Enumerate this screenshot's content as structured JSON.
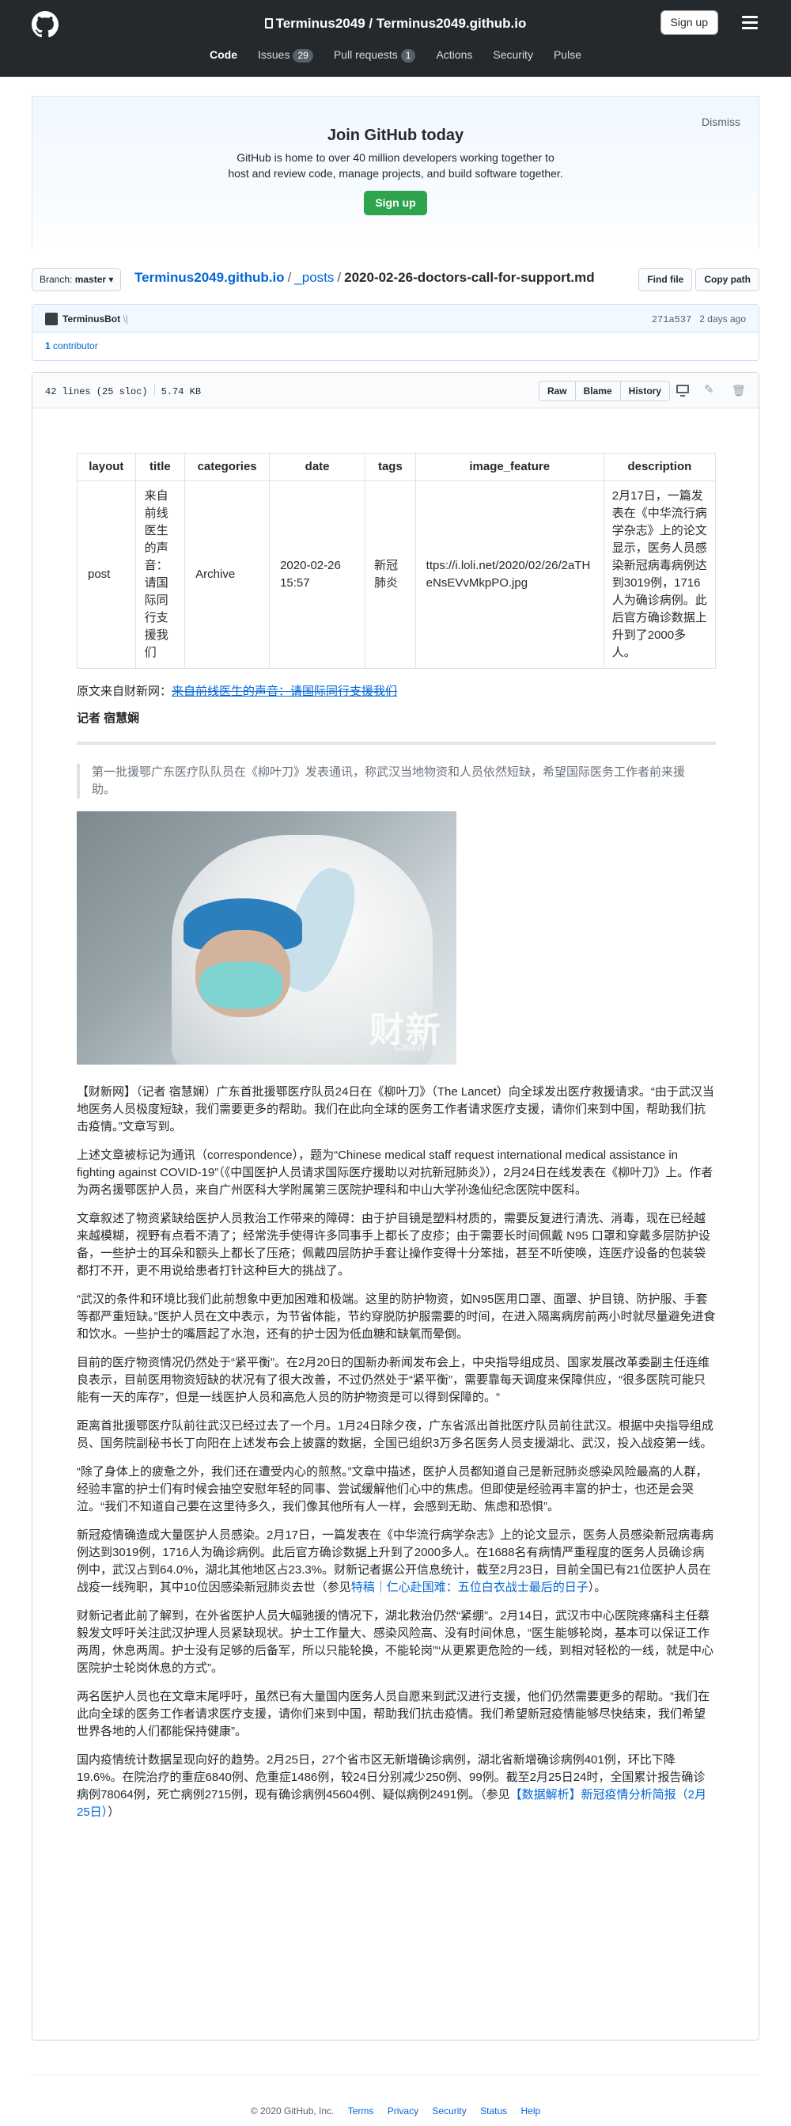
{
  "header": {
    "owner": "Terminus2049",
    "repo": "Terminus2049.github.io",
    "signin_label": "Sign up",
    "nav": [
      {
        "label": "Code",
        "active": true
      },
      {
        "label": "Issues",
        "count": "29"
      },
      {
        "label": "Pull requests",
        "count": "1"
      },
      {
        "label": "Actions"
      },
      {
        "label": "Security"
      },
      {
        "label": "Pulse"
      }
    ]
  },
  "join": {
    "title": "Join GitHub today",
    "text": "GitHub is home to over 40 million developers working together to host and review code, manage projects, and build software together.",
    "button": "Sign up",
    "dismiss": "Dismiss"
  },
  "filenav": {
    "branch_label": "Branch:",
    "branch": "master",
    "crumb_repo": "Terminus2049.github.io",
    "crumb_dir": "_posts",
    "crumb_file": "2020-02-26-doctors-call-for-support.md",
    "find_file": "Find file",
    "copy_path": "Copy path"
  },
  "commit": {
    "author": "TerminusBot",
    "message": "\\|",
    "sha": "271a537",
    "time": "2 days ago",
    "contributors_count": "1",
    "contributors_label": "contributor"
  },
  "file": {
    "lines": "42 lines (25 sloc)",
    "size": "5.74 KB",
    "raw": "Raw",
    "blame": "Blame",
    "history": "History"
  },
  "frontmatter": {
    "headers": [
      "layout",
      "title",
      "categories",
      "date",
      "tags",
      "image_feature",
      "description"
    ],
    "row": {
      "layout": "post",
      "title": "来自前线医生的声音：请国际同行支援我们",
      "categories": "Archive",
      "date": "2020-02-26 15:57",
      "tags": "新冠肺炎",
      "image_feature": "ttps://i.loli.net/2020/02/26/2aTHeNsEVvMkpPO.jpg",
      "description": "2月17日，一篇发表在《中华流行病学杂志》上的论文显示，医务人员感染新冠病毒病例达到3019例，1716人为确诊病例。此后官方确诊数据上升到了2000多人。"
    }
  },
  "article": {
    "source_prefix": "原文来自财新网：",
    "source_link": "来自前线医生的声音：请国际同行支援我们",
    "reporter": "记者 宿慧娴",
    "quote": "第一批援鄂广东医疗队队员在《柳叶刀》发表通讯，称武汉当地物资和人员依然短缺，希望国际医务工作者前来援助。",
    "photo_watermark": "财新",
    "photo_watermark_sub": "Caixin",
    "paragraphs": [
      "【财新网】（记者 宿慧娴）广东首批援鄂医疗队员24日在《柳叶刀》（The Lancet）向全球发出医疗救援请求。“由于武汉当地医务人员极度短缺，我们需要更多的帮助。我们在此向全球的医务工作者请求医疗支援，请你们来到中国，帮助我们抗击疫情。”文章写到。",
      "上述文章被标记为通讯（correspondence），题为“Chinese medical staff request international medical assistance in fighting against COVID-19”（《中国医护人员请求国际医疗援助以对抗新冠肺炎》），2月24日在线发表在《柳叶刀》上。作者为两名援鄂医护人员，来自广州医科大学附属第三医院护理科和中山大学孙逸仙纪念医院中医科。",
      "文章叙述了物资紧缺给医护人员救治工作带来的障碍：由于护目镜是塑料材质的，需要反复进行清洗、消毒，现在已经越来越模糊，视野有点看不清了；经常洗手使得许多同事手上都长了皮疹；由于需要长时间佩戴 N95 口罩和穿戴多层防护设备，一些护士的耳朵和额头上都长了压疮；佩戴四层防护手套让操作变得十分笨拙，甚至不听使唤，连医疗设备的包装袋都打不开，更不用说给患者打针这种巨大的挑战了。",
      "“武汉的条件和环境比我们此前想象中更加困难和极端。这里的防护物资，如N95医用口罩、面罩、护目镜、防护服、手套等都严重短缺。”医护人员在文中表示，为节省体能，节约穿脱防护服需要的时间，在进入隔离病房前两小时就尽量避免进食和饮水。一些护士的嘴唇起了水泡，还有的护士因为低血糖和缺氧而晕倒。",
      "目前的医疗物资情况仍然处于“紧平衡”。在2月20日的国新办新闻发布会上，中央指导组成员、国家发展改革委副主任连维良表示，目前医用物资短缺的状况有了很大改善，不过仍然处于“紧平衡”，需要靠每天调度来保障供应，“很多医院可能只能有一天的库存”，但是一线医护人员和高危人员的防护物资是可以得到保障的。“",
      "距离首批援鄂医疗队前往武汉已经过去了一个月。1月24日除夕夜，广东省派出首批医疗队员前往武汉。根据中央指导组成员、国务院副秘书长丁向阳在上述发布会上披露的数据，全国已组织3万多名医务人员支援湖北、武汉，投入战疫第一线。",
      "“除了身体上的疲惫之外，我们还在遭受内心的煎熬。”文章中描述，医护人员都知道自己是新冠肺炎感染风险最高的人群，经验丰富的护士们有时候会抽空安慰年轻的同事、尝试缓解他们心中的焦虑。但即使是经验再丰富的护士，也还是会哭泣。“我们不知道自己要在这里待多久，我们像其他所有人一样，会感到无助、焦虑和恐惧”。",
      "新冠疫情确造成大量医护人员感染。2月17日，一篇发表在《中华流行病学杂志》上的论文显示，医务人员感染新冠病毒病例达到3019例，1716人为确诊病例。此后官方确诊数据上升到了2000多人。在1688名有病情严重程度的医务人员确诊病例中，武汉占到64.0%，湖北其他地区占23.3%。财新记者据公开信息统计，截至2月23日，目前全国已有21位医护人员在战疫一线殉职，其中10位因感染新冠肺炎去世（参见",
      "财新记者此前了解到，在外省医护人员大幅驰援的情况下，湖北救治仍然“紧绷”。2月14日，武汉市中心医院疼痛科主任蔡毅发文呼吁关注武汉护理人员紧缺现状。护士工作量大、感染风险高、没有时间休息，“医生能够轮岗，基本可以保证工作两周，休息两周。护士没有足够的后备军，所以只能轮换，不能轮岗”“从更累更危险的一线，到相对轻松的一线，就是中心医院护士轮岗休息的方式”。",
      "两名医护人员也在文章末尾呼吁，虽然已有大量国内医务人员自愿来到武汉进行支援，他们仍然需要更多的帮助。“我们在此向全球的医务工作者请求医疗支援，请你们来到中国，帮助我们抗击疫情。我们希望新冠疫情能够尽快结束，我们希望世界各地的人们都能保持健康”。",
      "国内疫情统计数据呈现向好的趋势。2月25日，27个省市区无新增确诊病例，湖北省新增确诊病例401例，环比下降19.6%。在院治疗的重症6840例、危重症1486例，较24日分别减少250例、99例。截至2月25日24时，全国累计报告确诊病例78064例，死亡病例2715例，现有确诊病例45604例、疑似病例2491例。（参见"
    ],
    "link1": "特稿｜仁心赴国难：五位白衣战士最后的日子",
    "link1_suffix": "）。",
    "link2": "【数据解析】新冠疫情分析简报（2月25日）",
    "link2_suffix": "）"
  },
  "footer": {
    "copyright": "© 2020 GitHub, Inc.",
    "links": [
      "Terms",
      "Privacy",
      "Security",
      "Status",
      "Help"
    ]
  }
}
